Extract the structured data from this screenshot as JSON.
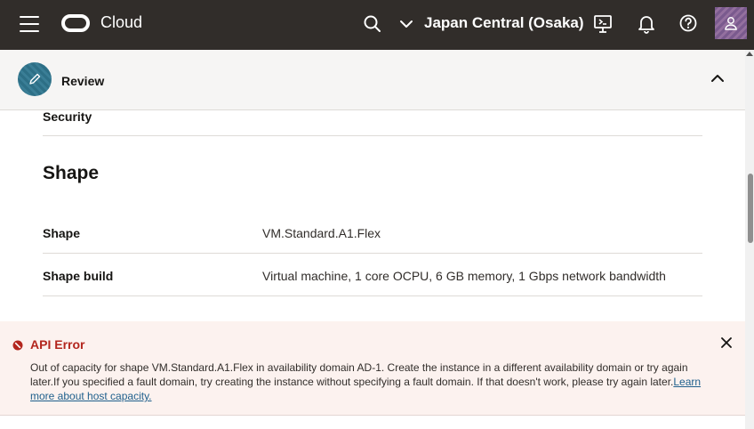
{
  "topbar": {
    "brand": "Cloud",
    "region": "Japan Central (Osaka)",
    "icons": [
      "menu-icon",
      "oracle-logo",
      "search-icon",
      "chevron-down-icon",
      "cloud-shell-icon",
      "bell-icon",
      "help-icon",
      "user-icon"
    ]
  },
  "review": {
    "title": "Review"
  },
  "details": {
    "security_label": "Security",
    "shape_section_title": "Shape",
    "rows": [
      {
        "label": "Shape",
        "value": "VM.Standard.A1.Flex"
      },
      {
        "label": "Shape build",
        "value": "Virtual machine, 1 core OCPU, 6 GB memory, 1 Gbps network bandwidth"
      }
    ]
  },
  "error": {
    "title": "API Error",
    "message": "Out of capacity for shape VM.Standard.A1.Flex in availability domain AD-1. Create the instance in a different availability domain or try again later.If you specified a fault domain, try creating the instance without specifying a fault domain. If that doesn't work, please try again later.",
    "link": "Learn more about host capacity."
  },
  "colors": {
    "topbar_bg": "#312d2a",
    "error_bg": "#fcf2ef",
    "error_accent": "#b3261e",
    "link": "#1e5f8c"
  }
}
